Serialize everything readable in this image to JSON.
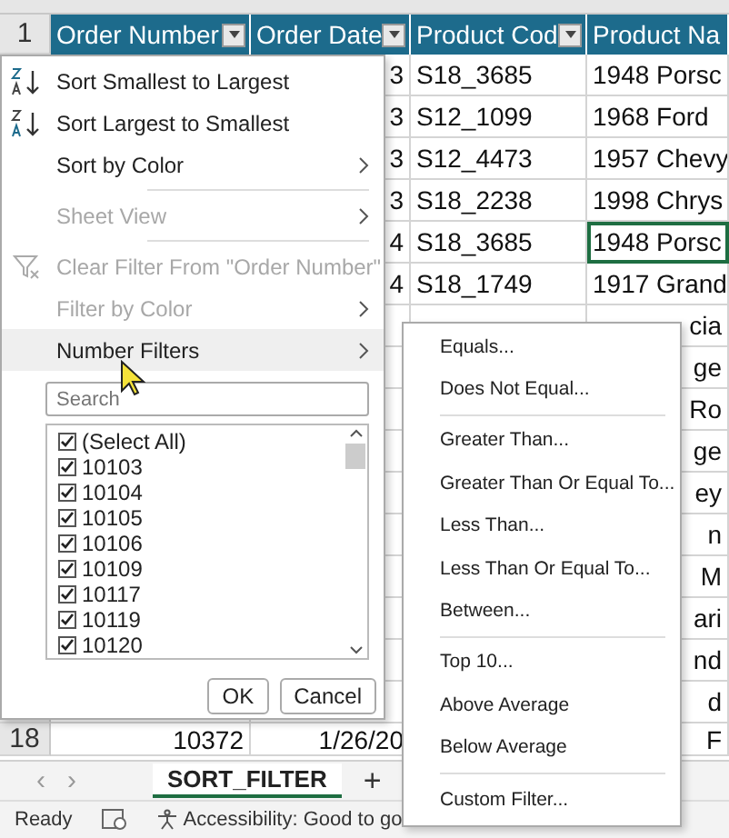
{
  "header_row": {
    "number": "1",
    "columns": [
      {
        "label": "Order Number",
        "filter_button": true
      },
      {
        "label": "Order Date",
        "filter_button": true
      },
      {
        "label": "Product Cod",
        "filter_button": true
      },
      {
        "label": "Product Na",
        "filter_button": false
      }
    ]
  },
  "rows": [
    {
      "order_date": "3",
      "product_code": "S18_3685",
      "product_name": "1948 Porsc",
      "selected": false
    },
    {
      "order_date": "3",
      "product_code": "S12_1099",
      "product_name": "1968 Ford",
      "selected": false
    },
    {
      "order_date": "3",
      "product_code": "S12_4473",
      "product_name": "1957 Chevy",
      "selected": false
    },
    {
      "order_date": "3",
      "product_code": "S18_2238",
      "product_name": "1998 Chrys",
      "selected": false
    },
    {
      "order_date": "4",
      "product_code": "S18_3685",
      "product_name": "1948 Porsc",
      "selected": true
    },
    {
      "order_date": "4",
      "product_code": "S18_1749",
      "product_name": "1917 Grand",
      "selected": false
    },
    {
      "product_name": "cia",
      "selected": false
    },
    {
      "product_name": "ge",
      "selected": false
    },
    {
      "product_name": "Ro",
      "selected": false
    },
    {
      "product_name": "ge",
      "selected": false
    },
    {
      "product_name": "ey",
      "selected": false
    },
    {
      "product_name": "n",
      "selected": false
    },
    {
      "product_name": "M",
      "selected": false
    },
    {
      "product_name": "ari",
      "selected": false
    },
    {
      "product_name": "nd",
      "selected": false
    },
    {
      "product_name": "d",
      "selected": false
    }
  ],
  "last_row": {
    "number": "18",
    "order_number": "10372",
    "order_date": "1/26/20",
    "product_name": "F"
  },
  "filter_menu": {
    "items": [
      {
        "kind": "sort-asc",
        "label": "Sort Smallest to Largest",
        "disabled": false,
        "submenu": false,
        "selected": false,
        "separator_before": false
      },
      {
        "kind": "sort-desc",
        "label": "Sort Largest to Smallest",
        "disabled": false,
        "submenu": false,
        "selected": false,
        "separator_before": false
      },
      {
        "kind": "plain",
        "label": "Sort by Color",
        "disabled": false,
        "submenu": true,
        "selected": false,
        "separator_before": false
      },
      {
        "kind": "plain",
        "label": "Sheet View",
        "disabled": true,
        "submenu": true,
        "selected": false,
        "separator_before": true
      },
      {
        "kind": "clear-filter",
        "label": "Clear Filter From \"Order Number\"",
        "disabled": true,
        "submenu": false,
        "selected": false,
        "separator_before": true
      },
      {
        "kind": "plain",
        "label": "Filter by Color",
        "disabled": true,
        "submenu": true,
        "selected": false,
        "separator_before": false
      },
      {
        "kind": "plain",
        "label": "Number Filters",
        "disabled": false,
        "submenu": true,
        "selected": true,
        "separator_before": false
      }
    ],
    "search": {
      "placeholder": "Search"
    },
    "values": [
      {
        "label": "(Select All)",
        "checked": true
      },
      {
        "label": "10103",
        "checked": true
      },
      {
        "label": "10104",
        "checked": true
      },
      {
        "label": "10105",
        "checked": true
      },
      {
        "label": "10106",
        "checked": true
      },
      {
        "label": "10109",
        "checked": true
      },
      {
        "label": "10117",
        "checked": true
      },
      {
        "label": "10119",
        "checked": true
      },
      {
        "label": "10120",
        "checked": true
      }
    ],
    "buttons": [
      "OK",
      "Cancel"
    ]
  },
  "number_filters_menu": {
    "items": [
      {
        "label": "Equals...",
        "separator_before": false
      },
      {
        "label": "Does Not Equal...",
        "separator_before": false
      },
      {
        "label": "Greater Than...",
        "separator_before": true
      },
      {
        "label": "Greater Than Or Equal To...",
        "separator_before": false
      },
      {
        "label": "Less Than...",
        "separator_before": false
      },
      {
        "label": "Less Than Or Equal To...",
        "separator_before": false
      },
      {
        "label": "Between...",
        "separator_before": false
      },
      {
        "label": "Top 10...",
        "separator_before": true
      },
      {
        "label": "Above Average",
        "separator_before": false
      },
      {
        "label": "Below Average",
        "separator_before": false
      },
      {
        "label": "Custom Filter...",
        "separator_before": true
      }
    ]
  },
  "sheet_nav": [
    "‹",
    "›"
  ],
  "sheet_tabs": [
    {
      "label": "SORT_FILTER",
      "selected": true
    }
  ],
  "new_sheet": "+",
  "status_bar": {
    "mode": "Ready",
    "accessibility": "Accessibility: Good to go"
  }
}
